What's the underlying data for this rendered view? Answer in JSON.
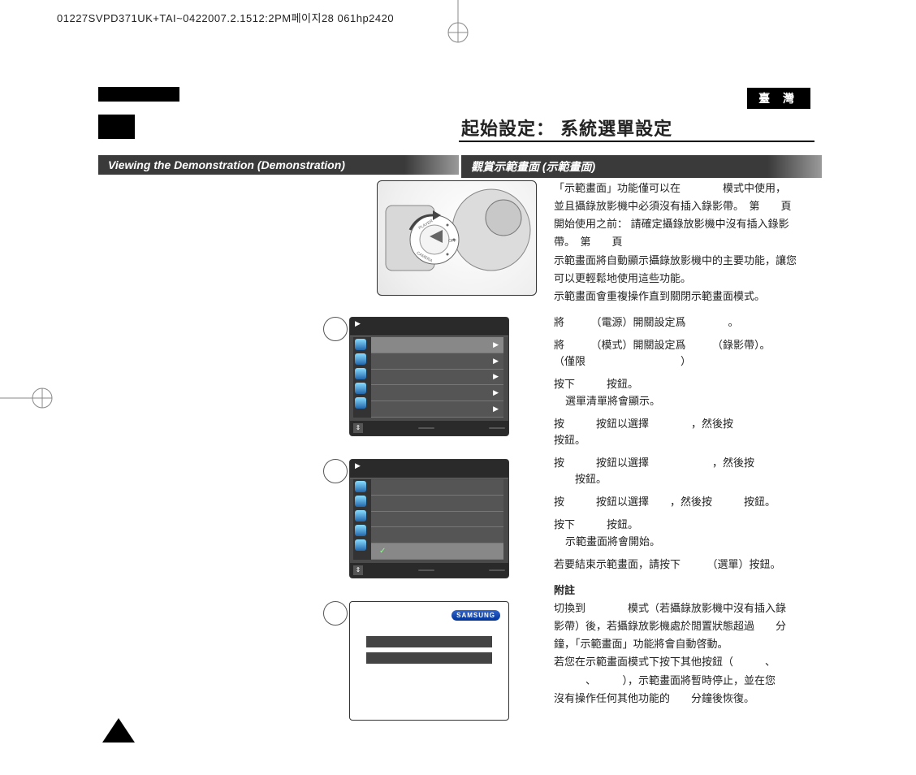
{
  "header_line": "01227SVPD371UK+TAI~0422007.2.1512:2PM페이지28 061hp2420",
  "language_badge": "臺 灣",
  "title_zh": "起始設定： 系統選單設定",
  "banner_en": "Viewing the Demonstration (Demonstration)",
  "banner_zh": "觀賞示範畫面 (示範畫面)",
  "intro": {
    "p1": "「示範畫面」功能僅可以在　　　　模式中使用，",
    "p2": "並且攝錄放影機中必須沒有插入錄影帶。　第　　頁",
    "p3": "開始使用之前： 請確定攝錄放影機中沒有插入錄影",
    "p4": "帶。　第　　頁",
    "p5": "示範畫面將自動顯示攝錄放影機中的主要功能，讓您",
    "p6": "可以更輕鬆地使用這些功能。",
    "p7": "示範畫面會重複操作直到關閉示範畫面模式。"
  },
  "steps": {
    "s1": "將　　　（電源）開關設定爲　　　　。",
    "s2a": "將　　　（模式）開關設定爲　　　（錄影帶）。",
    "s2b": "（僅限　　　　　　　　　）",
    "s3a": "按下　　　按鈕。",
    "s3b": "選單清單將會顯示。",
    "s4a": "按　　　按鈕以選擇　　　　，然後按",
    "s4b": "按鈕。",
    "s5a": "按　　　按鈕以選擇　　　　　　，然後按",
    "s5b": "　　按鈕。",
    "s6": "按　　　按鈕以選擇　　，然後按　　　按鈕。",
    "s7a": "按下　　　按鈕。",
    "s7b": "示範畫面將會開始。",
    "s8": "若要結束示範畫面，請按下　　　（選單）按鈕。"
  },
  "notes": {
    "title": "附註",
    "n1": "切換到　　　　模式（若攝錄放影機中沒有插入錄",
    "n2": "影帶）後，若攝錄放影機處於閒置狀態超過　　分",
    "n3": "鐘，「示範畫面」功能將會自動啓動。",
    "n4": "若您在示範畫面模式下按下其他按鈕（　　　、",
    "n5": "　　　、　　　），示範畫面將暫時停止，並在您",
    "n6": "沒有操作任何其他功能的　　分鐘後恢復。"
  },
  "samsung_brand": "SAMSUNG",
  "dial": {
    "player": "PLAYER",
    "off": "OFF",
    "camera": "CAMERA"
  }
}
